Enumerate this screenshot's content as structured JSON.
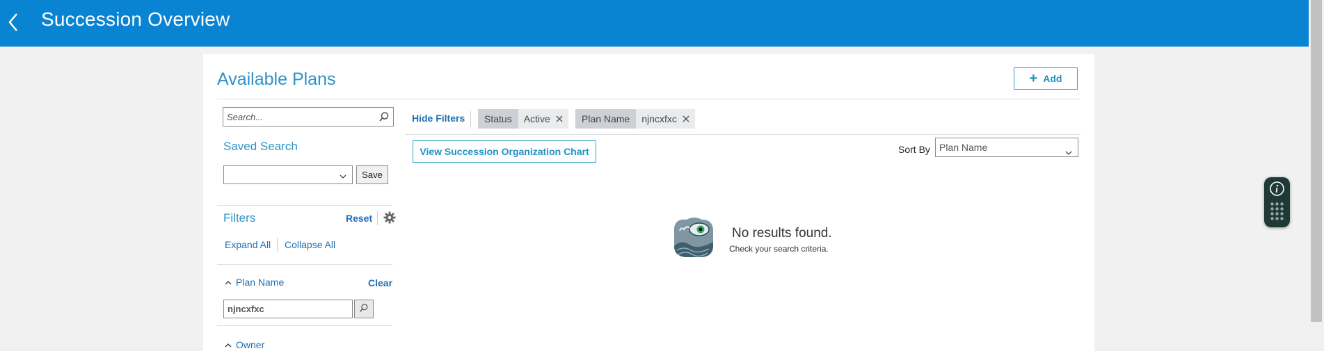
{
  "header": {
    "title": "Succession Overview"
  },
  "card": {
    "title": "Available Plans",
    "add_label": "Add"
  },
  "sidebar": {
    "search_placeholder": "Search...",
    "saved_search_label": "Saved Search",
    "saved_search_value": "",
    "save_label": "Save",
    "filters_label": "Filters",
    "reset_label": "Reset",
    "expand_all_label": "Expand All",
    "collapse_all_label": "Collapse All",
    "sections": [
      {
        "label": "Plan Name",
        "clear_label": "Clear",
        "value": "njncxfxc"
      },
      {
        "label": "Owner"
      }
    ]
  },
  "main": {
    "hide_filters_label": "Hide Filters",
    "chips": [
      {
        "key": "Status",
        "value": "Active"
      },
      {
        "key": "Plan Name",
        "value": "njncxfxc"
      }
    ],
    "view_chart_label": "View Succession Organization Chart",
    "sort_by_label": "Sort By",
    "sort_value": "Plan Name",
    "empty_title": "No results found.",
    "empty_subtitle": "Check your search criteria."
  },
  "colors": {
    "header_bg": "#0984d2",
    "accent": "#2c92c8",
    "link": "#1e6fb5",
    "button_border": "#2aa6c6"
  },
  "icons": [
    "back-arrow-icon",
    "plus-icon",
    "search-icon",
    "chevron-down-icon",
    "gear-icon",
    "close-icon",
    "chevron-up-icon",
    "no-results-illustration",
    "info-icon",
    "grid-dots-icon"
  ]
}
